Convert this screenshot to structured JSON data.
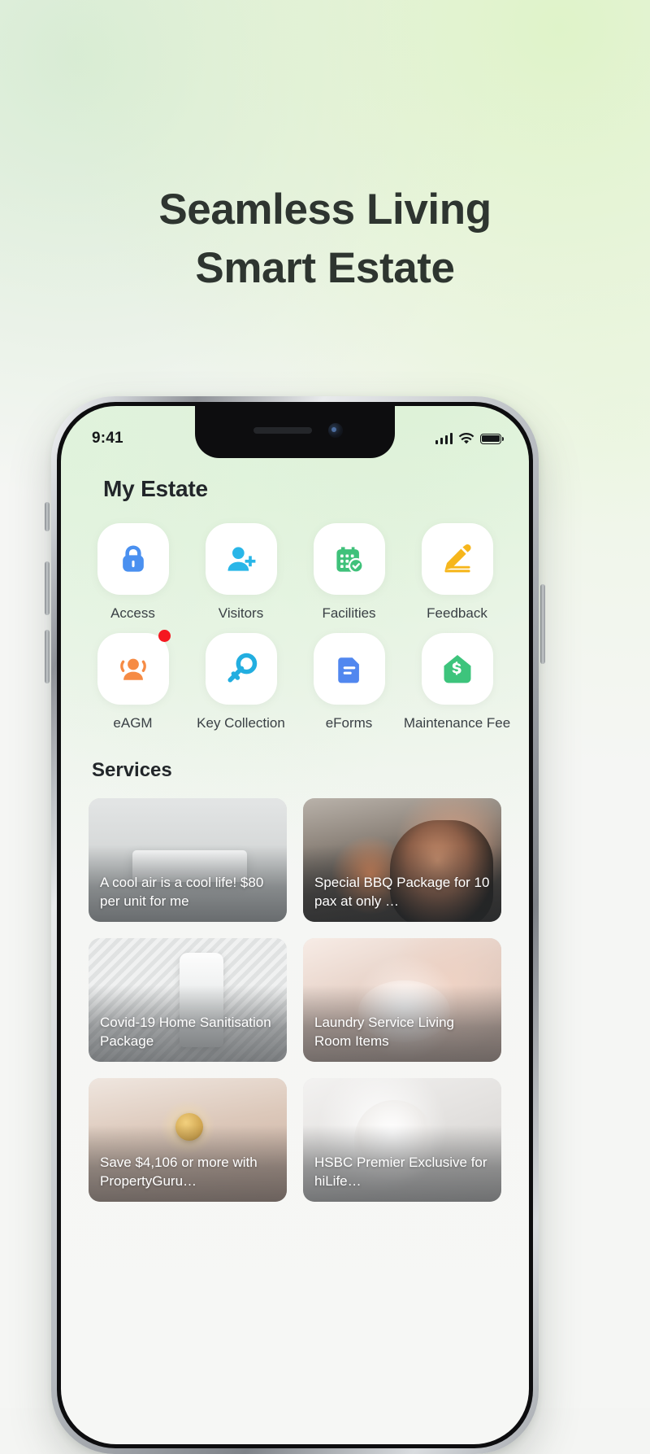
{
  "headline": {
    "line1": "Seamless Living",
    "line2": "Smart Estate"
  },
  "status_bar": {
    "time": "9:41",
    "signal_icon": "cellular-bars-icon",
    "wifi_icon": "wifi-icon",
    "battery_icon": "battery-icon"
  },
  "app": {
    "page_title": "My Estate",
    "quick_actions": [
      {
        "label": "Access",
        "icon": "lock-icon",
        "color": "#4a90f0",
        "badge": false
      },
      {
        "label": "Visitors",
        "icon": "person-add-icon",
        "color": "#29b6e8",
        "badge": false
      },
      {
        "label": "Facilities",
        "icon": "calendar-check-icon",
        "color": "#3fc17a",
        "badge": false
      },
      {
        "label": "Feedback",
        "icon": "pencil-edit-icon",
        "color": "#f6b61c",
        "badge": false
      },
      {
        "label": "eAGM",
        "icon": "people-group-icon",
        "color": "#f68b44",
        "badge": true
      },
      {
        "label": "Key Collection",
        "icon": "key-icon",
        "color": "#22aee0",
        "badge": false
      },
      {
        "label": "eForms",
        "icon": "document-icon",
        "color": "#5187ef",
        "badge": false
      },
      {
        "label": "Maintenance Fee",
        "icon": "house-dollar-icon",
        "color": "#3dc47c",
        "badge": false
      }
    ],
    "services": {
      "title": "Services",
      "cards": [
        {
          "caption": "A cool air is a cool life! $80 per unit for me",
          "photo": "ph-aircon",
          "photo_name": "air-conditioner-photo"
        },
        {
          "caption": "Special BBQ Package for 10 pax at only …",
          "photo": "ph-bbq",
          "photo_name": "bbq-chef-photo"
        },
        {
          "caption": "Covid-19 Home Sanitisation Package",
          "photo": "ph-sanitise",
          "photo_name": "sanitiser-spray-photo"
        },
        {
          "caption": "Laundry Service Living Room Items",
          "photo": "ph-laundry",
          "photo_name": "laundry-hands-photo"
        },
        {
          "caption": "Save $4,106 or more with PropertyGuru…",
          "photo": "ph-coins",
          "photo_name": "coins-savings-photo"
        },
        {
          "caption": "HSBC Premier Exclusive for hiLife…",
          "photo": "ph-hsbc",
          "photo_name": "hsbc-premier-photo"
        }
      ]
    }
  },
  "colors": {
    "badge_red": "#f5171f",
    "text_dark": "#22262a",
    "page_bg": "#f4f5f3"
  }
}
